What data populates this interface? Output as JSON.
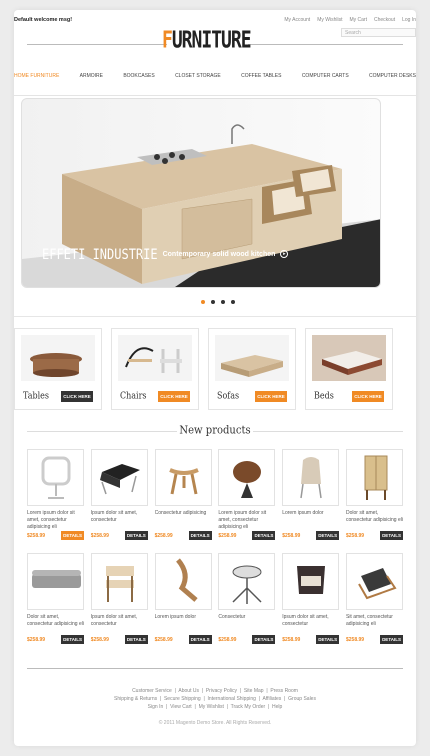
{
  "header": {
    "welcome": "Default welcome msg!",
    "links": [
      "My Account",
      "My Wishlist",
      "My Cart",
      "Checkout",
      "Log In"
    ],
    "search_placeholder": "Search",
    "logo_first": "F",
    "logo_rest": "URNITURE"
  },
  "nav": {
    "items": [
      "HOME FURNITURE",
      "ARMOIRE",
      "BOOKCASES",
      "CLOSET STORAGE",
      "COFFEE TABLES",
      "COMPUTER CARTS",
      "COMPUTER DESKS"
    ]
  },
  "slider": {
    "brand": "EFFETI INDUSTRIE",
    "caption": "Contemporary solid wood kitchen",
    "arrow": "▸",
    "dots_total": 4,
    "active_dot": 1
  },
  "categories": [
    {
      "name": "Tables",
      "button": "CLICK HERE",
      "button_color": "dark"
    },
    {
      "name": "Chairs",
      "button": "CLICK HERE",
      "button_color": "orange"
    },
    {
      "name": "Sofas",
      "button": "CLICK HERE",
      "button_color": "orange"
    },
    {
      "name": "Beds",
      "button": "CLICK HERE",
      "button_color": "orange"
    }
  ],
  "new_products": {
    "title": "New products",
    "rows": [
      [
        {
          "desc": "Lorem ipsum dolor sit amet, consectetur adipisicing eli",
          "price": "$258.99",
          "button": "DETAILS",
          "orange": true
        },
        {
          "desc": "Ipsum dolor sit amet, consectetur",
          "price": "$258.99",
          "button": "DETAILS",
          "orange": false
        },
        {
          "desc": "Consectetur adipisicing",
          "price": "$258.99",
          "button": "DETAILS",
          "orange": false
        },
        {
          "desc": "Lorem ipsum dolor sit amet, consectetur adipisicing eli",
          "price": "$258.99",
          "button": "DETAILS",
          "orange": false
        },
        {
          "desc": "Lorem ipsum dolor",
          "price": "$258.99",
          "button": "DETAILS",
          "orange": false
        },
        {
          "desc": "Dolor sit amet, consectetur adipisicing eli",
          "price": "$258.99",
          "button": "DETAILS",
          "orange": false
        }
      ],
      [
        {
          "desc": "Dolor sit amet, consectetur adipisicing eli",
          "price": "$258.99",
          "button": "DETAILS",
          "orange": false
        },
        {
          "desc": "Ipsum dolor sit amet, consectetur",
          "price": "$258.99",
          "button": "DETAILS",
          "orange": false
        },
        {
          "desc": "Lorem ipsum dolor",
          "price": "$258.99",
          "button": "DETAILS",
          "orange": false
        },
        {
          "desc": "Consectetur",
          "price": "$258.99",
          "button": "DETAILS",
          "orange": false
        },
        {
          "desc": "Ipsum dolor sit amet, consectetur",
          "price": "$258.99",
          "button": "DETAILS",
          "orange": false
        },
        {
          "desc": "Sit amet, consectetur adipisicing eli",
          "price": "$258.99",
          "button": "DETAILS",
          "orange": false
        }
      ]
    ]
  },
  "footer": {
    "row1": [
      "Customer Service",
      "About Us",
      "Privacy Policy",
      "Site Map",
      "Press Room"
    ],
    "row2": [
      "Shipping & Returns",
      "Secure Shipping",
      "International Shipping",
      "Affiliates",
      "Group Sales"
    ],
    "row3": [
      "Sign In",
      "View Cart",
      "My Wishlist",
      "Track My Order",
      "Help"
    ],
    "copyright": "© 2011 Magento Demo Store. All Rights Reserved."
  },
  "colors": {
    "accent": "#f08a24",
    "dark": "#333333"
  }
}
